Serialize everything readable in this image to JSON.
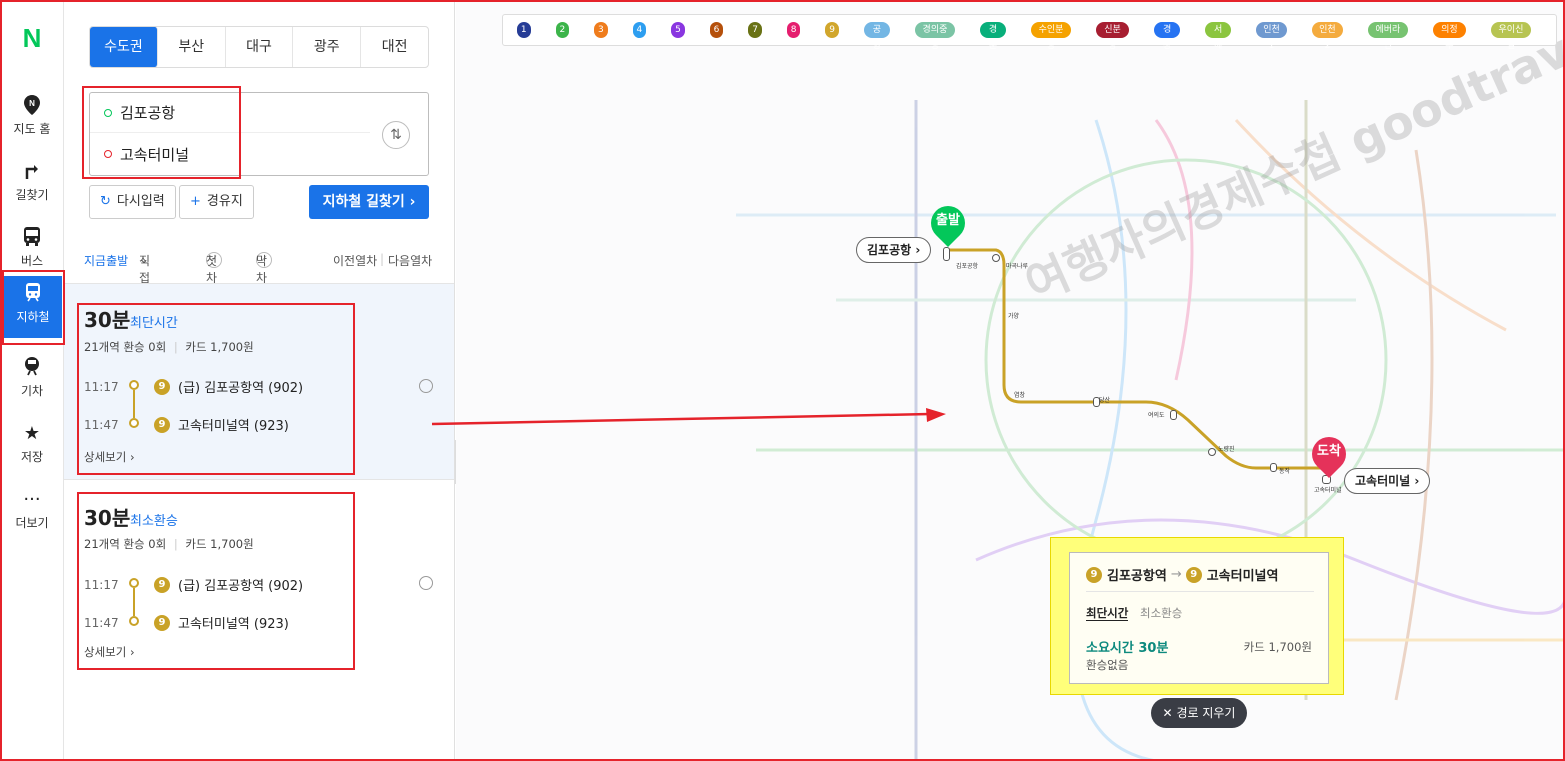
{
  "nav": {
    "logo": "N",
    "items": [
      {
        "label": "지도 홈",
        "icon": "map-pin-icon"
      },
      {
        "label": "길찾기",
        "icon": "directions-icon"
      },
      {
        "label": "버스",
        "icon": "bus-icon"
      },
      {
        "label": "지하철",
        "icon": "subway-icon"
      },
      {
        "label": "기차",
        "icon": "train-icon"
      },
      {
        "label": "저장",
        "icon": "star-icon"
      },
      {
        "label": "더보기",
        "icon": "more-icon"
      }
    ]
  },
  "regions": [
    "수도권",
    "부산",
    "대구",
    "광주",
    "대전"
  ],
  "search": {
    "origin": "김포공항",
    "destination": "고속터미널",
    "swap_icon": "swap-icon"
  },
  "actions": {
    "reset": "다시입력",
    "waypoint": "경유지",
    "submit": "지하철 길찾기"
  },
  "options": {
    "now": "지금출발",
    "custom": "직접설정",
    "first": "첫차",
    "last": "막차",
    "prev": "이전열차",
    "next": "다음열차"
  },
  "routes": [
    {
      "time": "30분",
      "tag": "최단시간",
      "stops": "21개역",
      "transfers": "환승 0회",
      "fare": "카드 1,700원",
      "dep_time": "11:17",
      "dep_station": "(급) 김포공항역 (902)",
      "arr_time": "11:47",
      "arr_station": "고속터미널역 (923)",
      "detail": "상세보기",
      "line": "9"
    },
    {
      "time": "30분",
      "tag": "최소환승",
      "stops": "21개역",
      "transfers": "환승 0회",
      "fare": "카드 1,700원",
      "dep_time": "11:17",
      "dep_station": "(급) 김포공항역 (902)",
      "arr_time": "11:47",
      "arr_station": "고속터미널역 (923)",
      "detail": "상세보기",
      "line": "9"
    }
  ],
  "lines": [
    {
      "label": "1",
      "color": "#263c96"
    },
    {
      "label": "2",
      "color": "#3cb44a"
    },
    {
      "label": "3",
      "color": "#ef7c1c"
    },
    {
      "label": "4",
      "color": "#2d9ef0"
    },
    {
      "label": "5",
      "color": "#8936e0"
    },
    {
      "label": "6",
      "color": "#b5500b"
    },
    {
      "label": "7",
      "color": "#697215"
    },
    {
      "label": "8",
      "color": "#e51e6e"
    },
    {
      "label": "9",
      "color": "#d1a62c"
    },
    {
      "label": "공항",
      "color": "#73b6e4"
    },
    {
      "label": "경의중앙",
      "color": "#7bc4a5"
    },
    {
      "label": "경춘",
      "color": "#08af7b"
    },
    {
      "label": "수인분당",
      "color": "#f5a200"
    },
    {
      "label": "신분당",
      "color": "#a71e31"
    },
    {
      "label": "경강",
      "color": "#2673f2"
    },
    {
      "label": "서해",
      "color": "#8bc53f"
    },
    {
      "label": "인천1",
      "color": "#6f99d0"
    },
    {
      "label": "인천2",
      "color": "#f4ab3e"
    },
    {
      "label": "에버라인",
      "color": "#77c371"
    },
    {
      "label": "의정부",
      "color": "#fd8100"
    },
    {
      "label": "우이신설",
      "color": "#b7c452"
    }
  ],
  "map": {
    "start_pin": "출발",
    "end_pin": "도착",
    "start_label": "김포공항",
    "end_label": "고속터미널",
    "stations": [
      "김포공항",
      "마곡나루",
      "가양",
      "염창",
      "당산",
      "여의도",
      "노량진",
      "동작",
      "고속터미널"
    ],
    "info": {
      "from": "김포공항역",
      "to": "고속터미널역",
      "tab_fast": "최단시간",
      "tab_min": "최소환승",
      "duration": "소요시간 30분",
      "fare": "카드 1,700원",
      "transfer": "환승없음"
    },
    "clear": "경로 지우기",
    "watermark": "여행자의경제수첩 goodtravel.tistory.com"
  }
}
